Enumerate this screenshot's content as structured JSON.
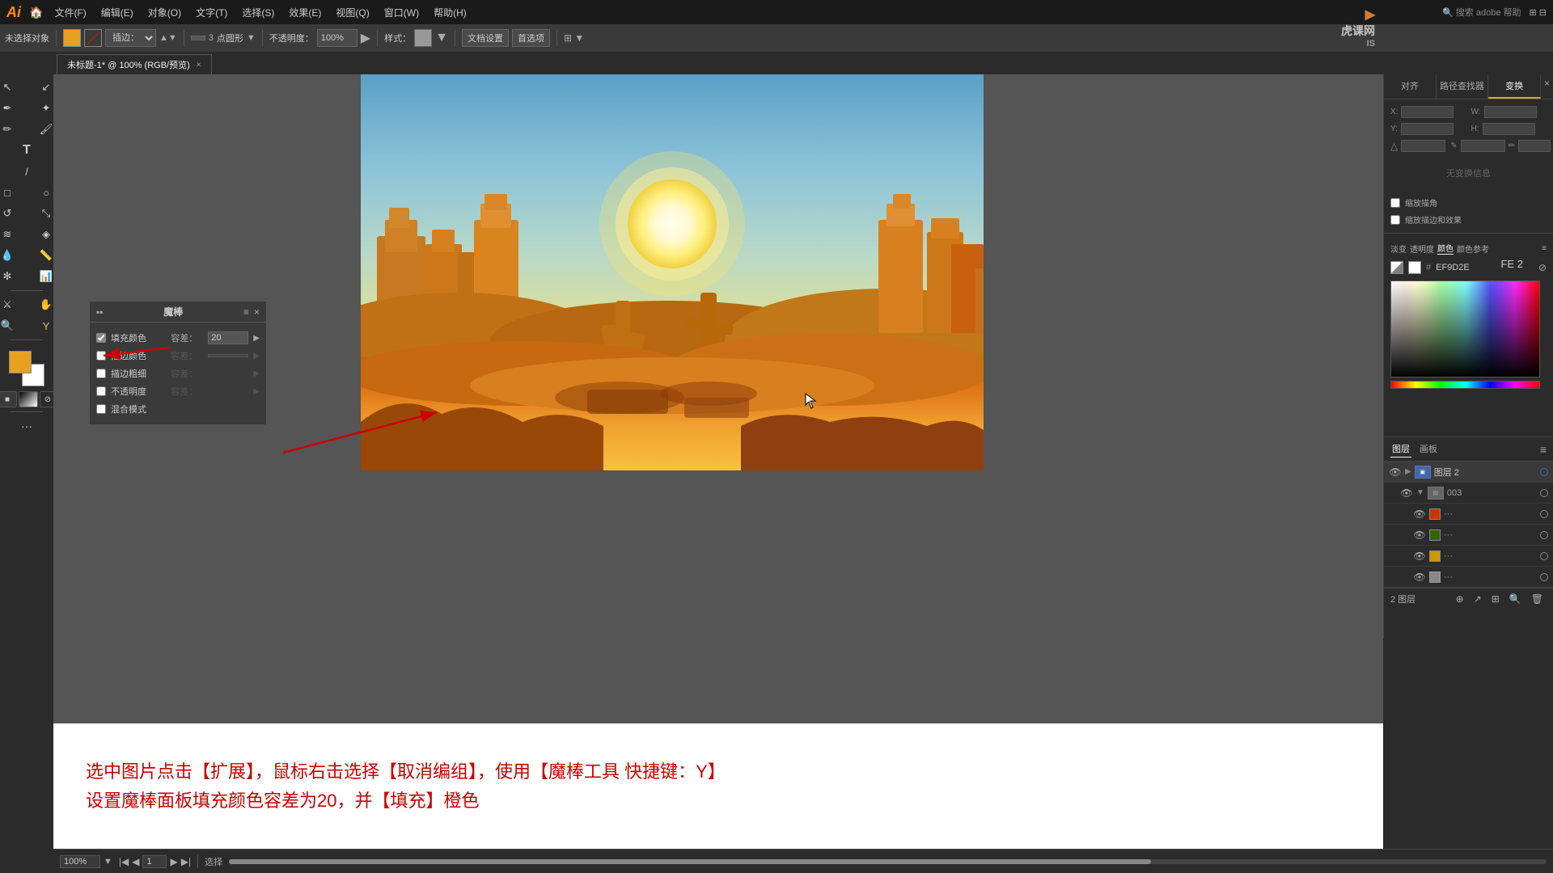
{
  "app": {
    "name": "Adobe Illustrator",
    "logo": "Ai",
    "version": ""
  },
  "menu": {
    "items": [
      "文件(F)",
      "编辑(E)",
      "对象(O)",
      "文字(T)",
      "选择(S)",
      "效果(E)",
      "视图(Q)",
      "窗口(W)",
      "帮助(H)"
    ]
  },
  "toolbar": {
    "no_selection": "未选择对象",
    "stroke_label": "描边：",
    "blend_label": "插边：",
    "opacity_label": "不透明度：",
    "opacity_value": "100%",
    "style_label": "样式：",
    "doc_settings": "文档设置",
    "preferences": "首选项",
    "brush_size": "3",
    "brush_type": "点圆形"
  },
  "tab": {
    "title": "未标题-1*",
    "subtitle": "100% (RGB/预览)",
    "close_label": "×"
  },
  "magic_wand": {
    "title": "魔棒",
    "fill_color_label": "填充颜色",
    "fill_checked": true,
    "fill_tolerance_label": "容差：",
    "fill_tolerance_value": "20",
    "stroke_color_label": "描边颜色",
    "stroke_tolerance_label": "容差：",
    "stroke_width_label": "描边粗细",
    "stroke_width_tolerance": "容差：",
    "opacity_label": "不透明度",
    "blend_mode_label": "混合模式"
  },
  "instruction": {
    "line1": "选中图片点击【扩展】，鼠标右击选择【取消编组】，使用【魔棒工具 快捷键：Y】",
    "line2": "设置魔棒面板填充颜色容差为20，并【填充】橙色"
  },
  "right_panel": {
    "tabs": [
      "对齐",
      "路径查找器",
      "变换"
    ],
    "active_tab": "变换",
    "no_selection": "无变换信息",
    "checkboxes": [
      "缩放描角",
      "缩放描边和效果"
    ],
    "options_label": "淡变",
    "transparency_label": "透明度",
    "color_label": "颜色",
    "color_reference_label": "颜色参考",
    "hex_value": "EF9D2E"
  },
  "layers": {
    "panel_title": "图层",
    "canvas_title": "画板",
    "items": [
      {
        "name": "图层 2",
        "type": "group",
        "visible": true,
        "expanded": true,
        "color": "blue"
      },
      {
        "name": "003",
        "type": "item",
        "visible": true,
        "expanded": false
      },
      {
        "name": "...",
        "type": "color",
        "color": "red",
        "visible": true
      },
      {
        "name": "...",
        "type": "color",
        "color": "green",
        "visible": true
      },
      {
        "name": "...",
        "type": "color",
        "color": "yellow",
        "visible": true
      },
      {
        "name": "...",
        "type": "color",
        "color": "multi",
        "visible": true
      }
    ],
    "footer_label": "2 图层"
  },
  "status_bar": {
    "zoom": "100%",
    "page": "1",
    "selection_label": "选择",
    "fe2_label": "FE 2"
  },
  "watermark": {
    "site": "虎课网",
    "code": "IS"
  }
}
